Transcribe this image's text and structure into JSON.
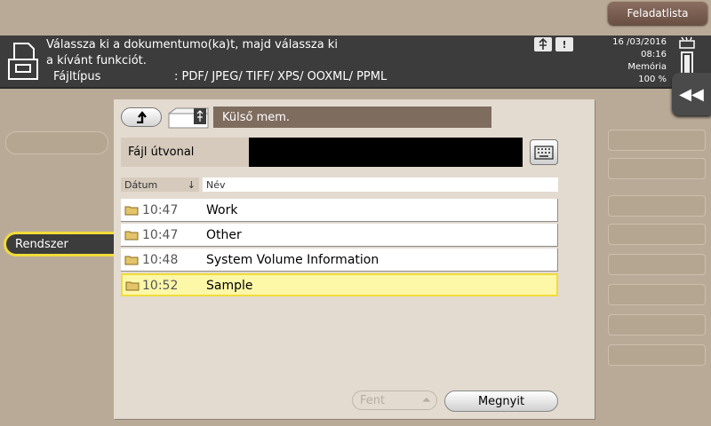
{
  "topbar": {
    "job_list_label": "Feladatlista"
  },
  "header": {
    "message_line1": "Válassza ki a dokumentumo(ka)t, majd válassza ki",
    "message_line2": "a kívánt funkciót.",
    "filetype_label": "Fájltípus",
    "filetype_value": ": PDF/ JPEG/ TIFF/ XPS/ OOXML/ PPML",
    "date": "16 /03/2016",
    "time": "08:16",
    "memory_label": "Memória",
    "memory_value": "100 %",
    "memory_level": 1.0,
    "icons": [
      "usb-icon",
      "warning-icon",
      "toner-icon"
    ]
  },
  "sidebar": {
    "system_tab": "Rendszer"
  },
  "panel": {
    "location": "Külső mem.",
    "path_label": "Fájl útvonal",
    "path_value": "",
    "columns": {
      "date": "Dátum",
      "name": "Név"
    },
    "files": [
      {
        "time": "10:47",
        "name": "Work",
        "selected": false
      },
      {
        "time": "10:47",
        "name": "Other",
        "selected": false
      },
      {
        "time": "10:48",
        "name": "System Volume Information",
        "selected": false
      },
      {
        "time": "10:52",
        "name": "Sample",
        "selected": true
      }
    ],
    "up_button": "Fent",
    "open_button": "Megnyit"
  },
  "colors": {
    "accent": "#f1dc39",
    "header_bg": "#3c3c3c",
    "location_bg": "#7e6c5f"
  }
}
